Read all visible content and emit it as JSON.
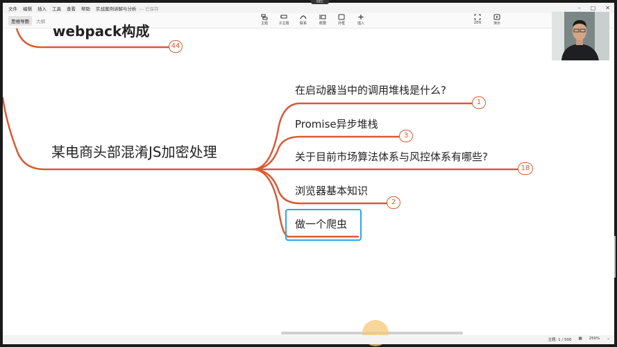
{
  "menu": [
    "文件",
    "编辑",
    "插入",
    "工具",
    "查看",
    "帮助"
  ],
  "document_title": "实战案例讲解与分析",
  "saved_status": "— 已保存",
  "recording_badge": "REC",
  "view_tabs": [
    {
      "label": "思维导图",
      "active": true
    },
    {
      "label": "大纲",
      "active": false
    }
  ],
  "tools": [
    {
      "name": "topic",
      "label": "主题",
      "icon": "topic-icon"
    },
    {
      "name": "subtopic",
      "label": "子主题",
      "icon": "subtopic-icon"
    },
    {
      "name": "relationship",
      "label": "联系",
      "icon": "relationship-icon"
    },
    {
      "name": "summary",
      "label": "概要",
      "icon": "summary-icon"
    },
    {
      "name": "boundary",
      "label": "外框",
      "icon": "boundary-icon"
    },
    {
      "name": "insert",
      "label": "插入",
      "icon": "plus-icon"
    },
    {
      "name": "zen",
      "label": "ZEN",
      "icon": "zen-icon"
    },
    {
      "name": "present",
      "label": "演示",
      "icon": "play-icon"
    }
  ],
  "mindmap": {
    "top_partial": "webpack构成",
    "top_badge": "44",
    "root": "某电商头部混淆JS加密处理",
    "branches": [
      {
        "label": "在启动器当中的调用堆栈是什么?",
        "badge": "1"
      },
      {
        "label": "Promise异步堆栈",
        "badge": "3"
      },
      {
        "label": "关于目前市场算法体系与风控体系有哪些?",
        "badge": "18"
      },
      {
        "label": "浏览器基本知识",
        "badge": "2"
      },
      {
        "label": "做一个爬虫",
        "badge": ""
      }
    ],
    "line_color": "#d85a35",
    "selection_color": "#2ea6e6"
  },
  "status": {
    "topic_count": "主题: 1 / 500",
    "zoom": "250%"
  }
}
